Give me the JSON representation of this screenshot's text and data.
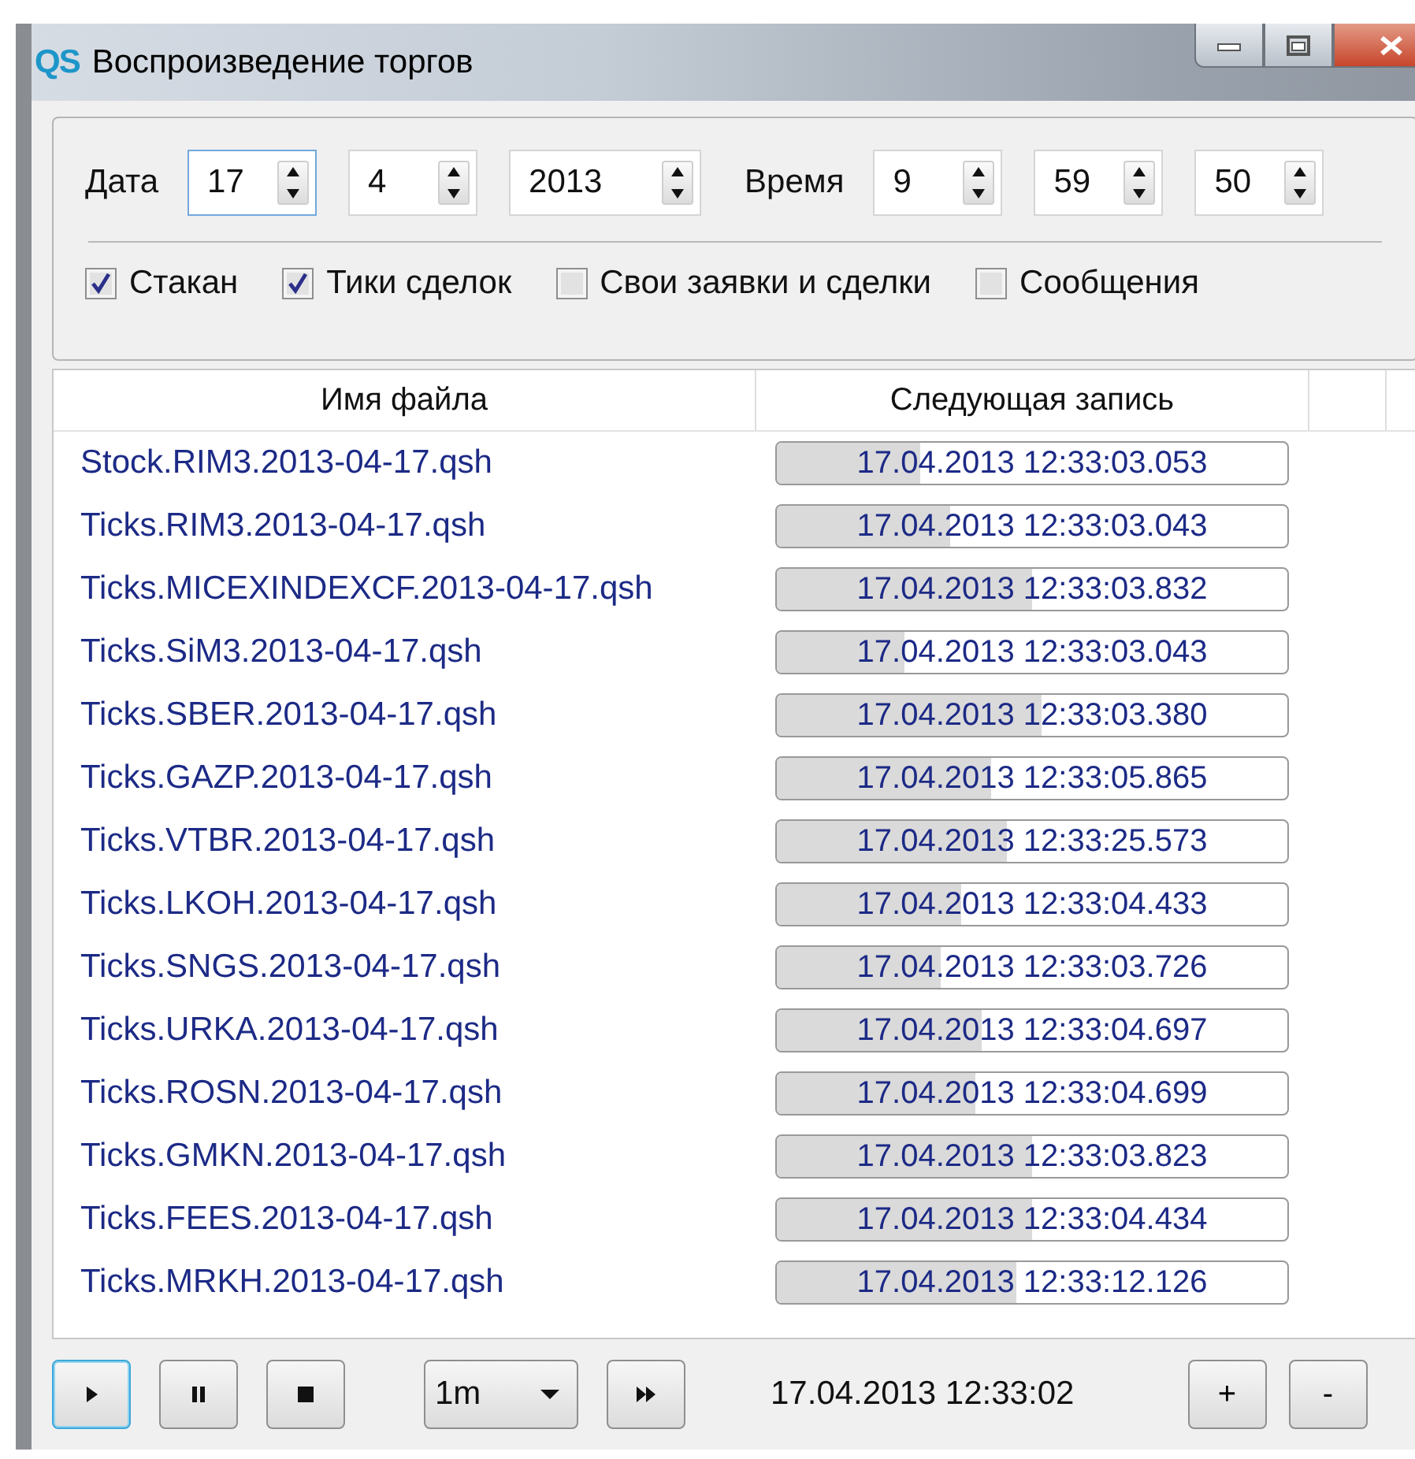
{
  "window": {
    "title": "Воспроизведение торгов",
    "logo": "QS"
  },
  "date": {
    "label": "Дата",
    "fields": [
      {
        "value": "17",
        "focused": true
      },
      {
        "value": "4",
        "focused": false
      },
      {
        "value": "2013",
        "focused": false
      }
    ]
  },
  "time": {
    "label": "Время",
    "fields": [
      {
        "value": "9",
        "focused": false
      },
      {
        "value": "59",
        "focused": false
      },
      {
        "value": "50",
        "focused": false
      }
    ]
  },
  "options": [
    {
      "label": "Стакан",
      "checked": true
    },
    {
      "label": "Тики сделок",
      "checked": true
    },
    {
      "label": "Свои заявки и сделки",
      "checked": false
    },
    {
      "label": "Сообщения",
      "checked": false
    }
  ],
  "table": {
    "columns": [
      "Имя файла",
      "Следующая запись"
    ],
    "rows": [
      {
        "file": "Stock.RIM3.2013-04-17.qsh",
        "next": "17.04.2013 12:33:03.053",
        "level": 0.28
      },
      {
        "file": "Ticks.RIM3.2013-04-17.qsh",
        "next": "17.04.2013 12:33:03.043",
        "level": 0.34
      },
      {
        "file": "Ticks.MICEXINDEXCF.2013-04-17.qsh",
        "next": "17.04.2013 12:33:03.832",
        "level": 0.5
      },
      {
        "file": "Ticks.SiM3.2013-04-17.qsh",
        "next": "17.04.2013 12:33:03.043",
        "level": 0.25
      },
      {
        "file": "Ticks.SBER.2013-04-17.qsh",
        "next": "17.04.2013 12:33:03.380",
        "level": 0.52
      },
      {
        "file": "Ticks.GAZP.2013-04-17.qsh",
        "next": "17.04.2013 12:33:05.865",
        "level": 0.42
      },
      {
        "file": "Ticks.VTBR.2013-04-17.qsh",
        "next": "17.04.2013 12:33:25.573",
        "level": 0.45
      },
      {
        "file": "Ticks.LKOH.2013-04-17.qsh",
        "next": "17.04.2013 12:33:04.433",
        "level": 0.36
      },
      {
        "file": "Ticks.SNGS.2013-04-17.qsh",
        "next": "17.04.2013 12:33:03.726",
        "level": 0.32
      },
      {
        "file": "Ticks.URKA.2013-04-17.qsh",
        "next": "17.04.2013 12:33:04.697",
        "level": 0.4
      },
      {
        "file": "Ticks.ROSN.2013-04-17.qsh",
        "next": "17.04.2013 12:33:04.699",
        "level": 0.39
      },
      {
        "file": "Ticks.GMKN.2013-04-17.qsh",
        "next": "17.04.2013 12:33:03.823",
        "level": 0.5
      },
      {
        "file": "Ticks.FEES.2013-04-17.qsh",
        "next": "17.04.2013 12:33:04.434",
        "level": 0.5
      },
      {
        "file": "Ticks.MRKH.2013-04-17.qsh",
        "next": "17.04.2013 12:33:12.126",
        "level": 0.47
      }
    ]
  },
  "controls": {
    "play_buttons": [
      {
        "kind": "play",
        "focused": true
      },
      {
        "kind": "pause",
        "focused": false
      },
      {
        "kind": "stop",
        "focused": false
      }
    ],
    "speed": "1m",
    "clock": "17.04.2013 12:33:02",
    "zoom_buttons": [
      "+",
      "-"
    ]
  }
}
